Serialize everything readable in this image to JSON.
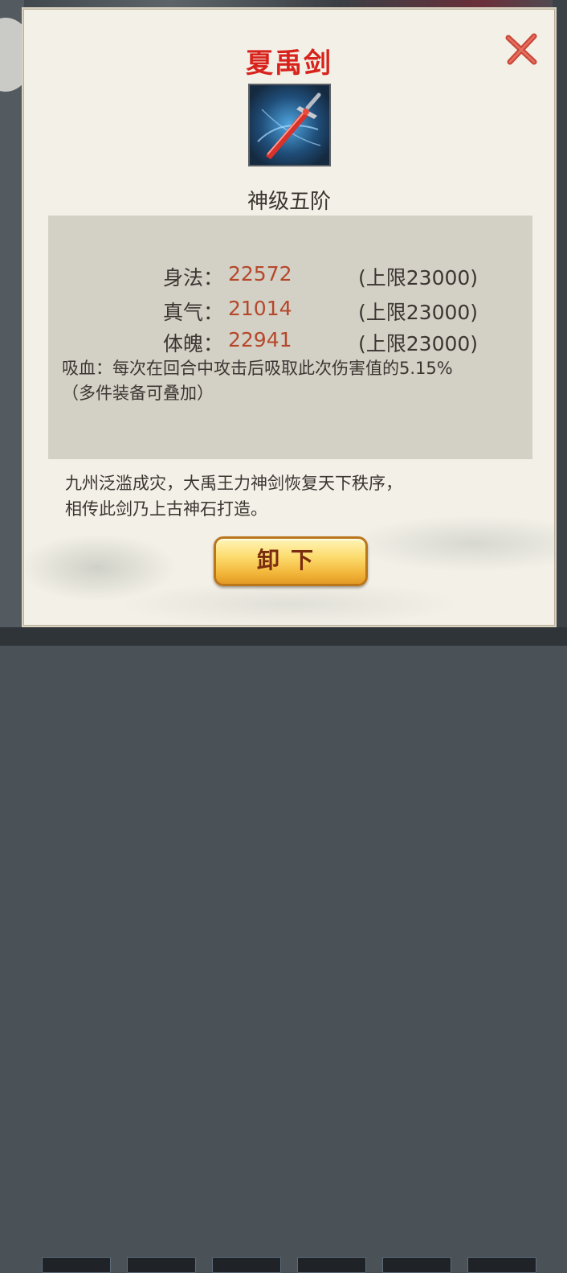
{
  "dialog": {
    "title": "夏禹剑",
    "grade": "神级五阶",
    "stats": [
      {
        "label": "身法：",
        "value": "22572",
        "cap": "(上限23000)"
      },
      {
        "label": "真气：",
        "value": "21014",
        "cap": "(上限23000)"
      },
      {
        "label": "体魄：",
        "value": "22941",
        "cap": "(上限23000)"
      }
    ],
    "effect_line1": "吸血：每次在回合中攻击后吸取此次伤害值的5.15%",
    "effect_line2": "（多件装备可叠加）",
    "description_line1": "九州泛滥成灾，大禹王力神剑恢复天下秩序，",
    "description_line2": "相传此剑乃上古神石打造。",
    "unequip_label": "卸下",
    "close_icon": "close-x-icon",
    "item_icon": "sword-icon"
  },
  "colors": {
    "title": "#d8231d",
    "stat_value": "#b5482b",
    "panel": "#d3d0c6",
    "dialog_bg": "#f3f0e7",
    "button_gold": "#f3b73c"
  }
}
